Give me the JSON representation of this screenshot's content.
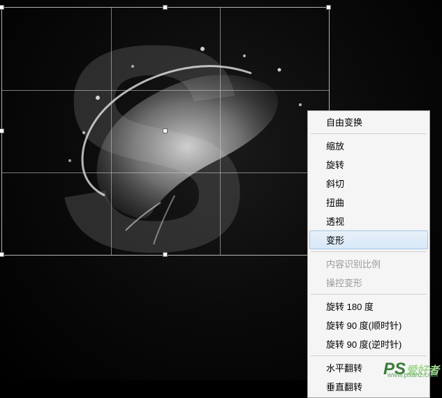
{
  "canvas": {
    "letter": "S"
  },
  "contextMenu": {
    "items": [
      {
        "label": "自由变换",
        "type": "item"
      },
      {
        "type": "sep"
      },
      {
        "label": "缩放",
        "type": "item"
      },
      {
        "label": "旋转",
        "type": "item"
      },
      {
        "label": "斜切",
        "type": "item"
      },
      {
        "label": "扭曲",
        "type": "item"
      },
      {
        "label": "透视",
        "type": "item"
      },
      {
        "label": "变形",
        "type": "item",
        "highlighted": true
      },
      {
        "type": "sep"
      },
      {
        "label": "内容识别比例",
        "type": "item",
        "disabled": true
      },
      {
        "label": "操控变形",
        "type": "item",
        "disabled": true
      },
      {
        "type": "sep"
      },
      {
        "label": "旋转 180 度",
        "type": "item"
      },
      {
        "label": "旋转 90 度(顺时针)",
        "type": "item"
      },
      {
        "label": "旋转 90 度(逆时针)",
        "type": "item"
      },
      {
        "type": "sep"
      },
      {
        "label": "水平翻转",
        "type": "item"
      },
      {
        "label": "垂直翻转",
        "type": "item"
      }
    ]
  },
  "watermark": {
    "brand_prefix": "PS",
    "brand_text": "爱好者",
    "url": "www.psahz.com"
  }
}
